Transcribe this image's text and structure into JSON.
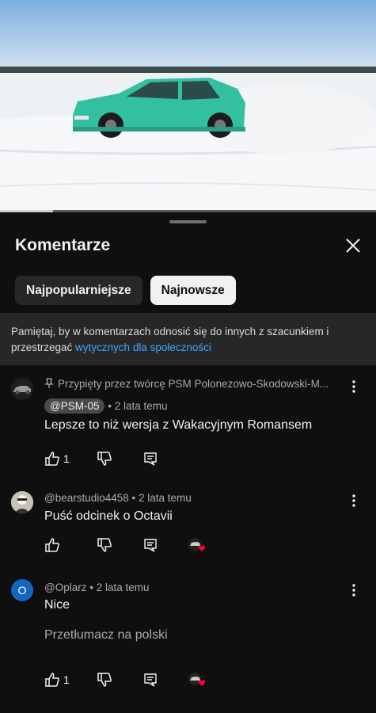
{
  "panel": {
    "title": "Komentarze",
    "chips": [
      "Najpopularniejsze",
      "Najnowsze"
    ],
    "active_chip": "Najnowsze",
    "notice_text": "Pamiętaj, by w komentarzach odnosić się do innych z szacunkiem i przestrzegać ",
    "notice_link": "wytycznych dla społeczności"
  },
  "video": {
    "progress_fraction": 0.14
  },
  "comments": [
    {
      "pinned_label": "Przypięty przez twórcę PSM Polonezowo-Skodowski-M...",
      "author": "@PSM-05",
      "age": "• 2 lata temu",
      "text": "Lepsze to niż wersja z Wakacyjnym Romansem",
      "likes": "1"
    },
    {
      "author": "@bearstudio4458",
      "age": "• 2 lata temu",
      "text": "Puść odcinek o Octavii",
      "likes": ""
    },
    {
      "avatar_letter": "O",
      "author": "@Oplarz",
      "age": "• 2 lata temu",
      "text": "Nice",
      "translate": "Przetłumacz na polski",
      "likes": "1"
    }
  ],
  "colors": {
    "accent_link": "#3ea6ff",
    "car": "#33c0a0",
    "avatar_blue": "#1565c0",
    "heart": "#ff0033"
  }
}
